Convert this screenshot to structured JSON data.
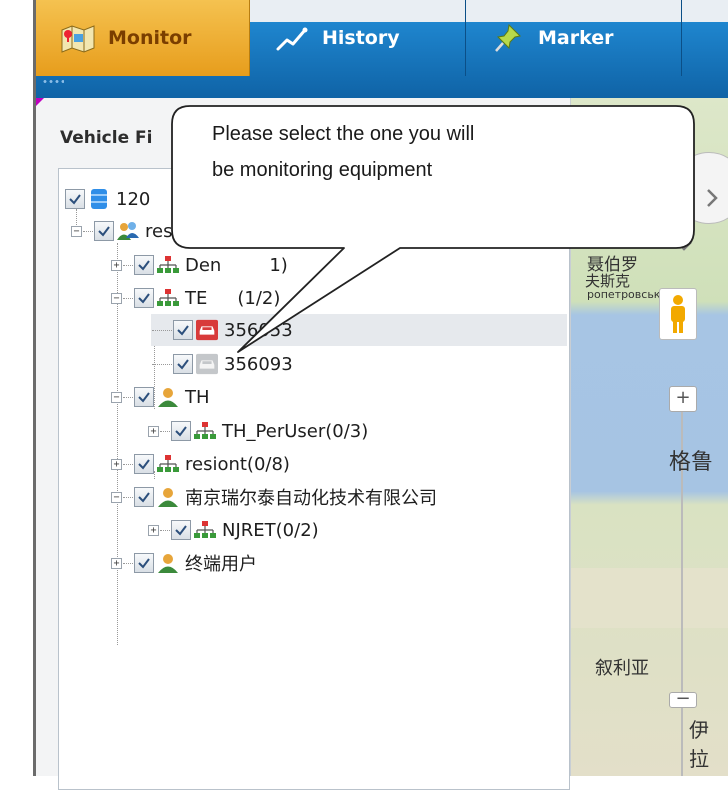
{
  "toolbar": {
    "monitor_label": "Monitor",
    "history_label": "History",
    "marker_label": "Marker"
  },
  "panel": {
    "title": "Vehicle Fi"
  },
  "tree": {
    "root": "120",
    "resiont": "resiont",
    "den": "Den",
    "den_count": "1)",
    "te_label": "TE",
    "te_count": "(1/2)",
    "v1": "356053",
    "v2": "356093",
    "th": "TH",
    "th_peruser": "TH_PerUser(0/3)",
    "resiont2": "resiont(0/8)",
    "company": "南京瑞尔泰自动化技术有限公司",
    "njret": "NJRET(0/2)",
    "terminal": "终端用户"
  },
  "map": {
    "label1": "聂伯罗",
    "label2": "夫斯克",
    "label3": "ропетровськ",
    "label4": "格鲁",
    "label5": "叙利亚",
    "label6": "伊拉",
    "zoom_in": "+",
    "zoom_out": "−"
  },
  "callout": {
    "line1": "Please select the one you will",
    "line2": "be monitoring equipment"
  },
  "colors": {
    "toolbar_blue": "#1579c0",
    "active_orange": "#f0b53a"
  }
}
